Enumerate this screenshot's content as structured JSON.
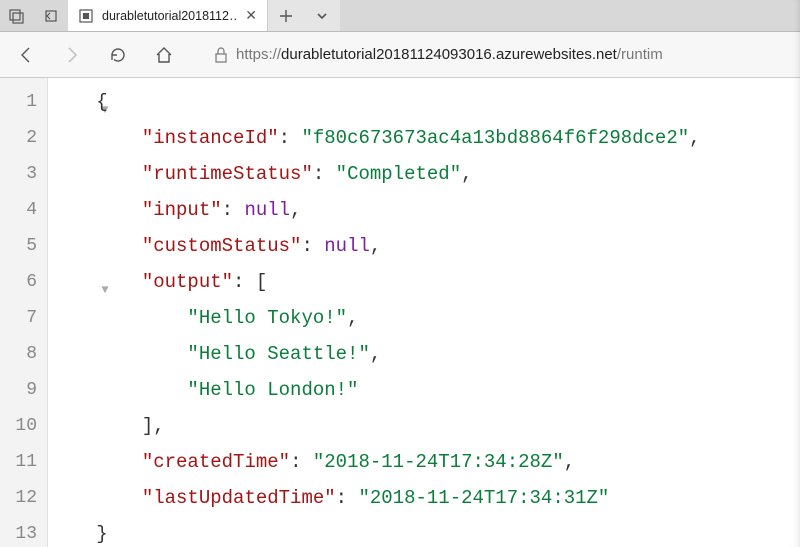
{
  "titlebar": {
    "tab_title": "durabletutorial2018112…",
    "favicon_glyph": "⊡"
  },
  "toolbar": {
    "url_proto": "https://",
    "url_host": "durabletutorial20181124093016.azurewebsites.net",
    "url_path": "/runtim"
  },
  "code": {
    "lines": [
      "1",
      "2",
      "3",
      "4",
      "5",
      "6",
      "7",
      "8",
      "9",
      "10",
      "11",
      "12",
      "13"
    ],
    "open_brace": "{",
    "close_brace": "}",
    "k_instanceId": "\"instanceId\"",
    "v_instanceId": "\"f80c673673ac4a13bd8864f6f298dce2\"",
    "k_runtimeStatus": "\"runtimeStatus\"",
    "v_runtimeStatus": "\"Completed\"",
    "k_input": "\"input\"",
    "v_null": "null",
    "k_customStatus": "\"customStatus\"",
    "k_output": "\"output\"",
    "open_bracket": "[",
    "close_bracket_comma": "],",
    "v_tokyo": "\"Hello Tokyo!\"",
    "v_seattle": "\"Hello Seattle!\"",
    "v_london": "\"Hello London!\"",
    "k_createdTime": "\"createdTime\"",
    "v_createdTime": "\"2018-11-24T17:34:28Z\"",
    "k_lastUpdatedTime": "\"lastUpdatedTime\"",
    "v_lastUpdatedTime": "\"2018-11-24T17:34:31Z\"",
    "colon": ": ",
    "comma": ","
  }
}
